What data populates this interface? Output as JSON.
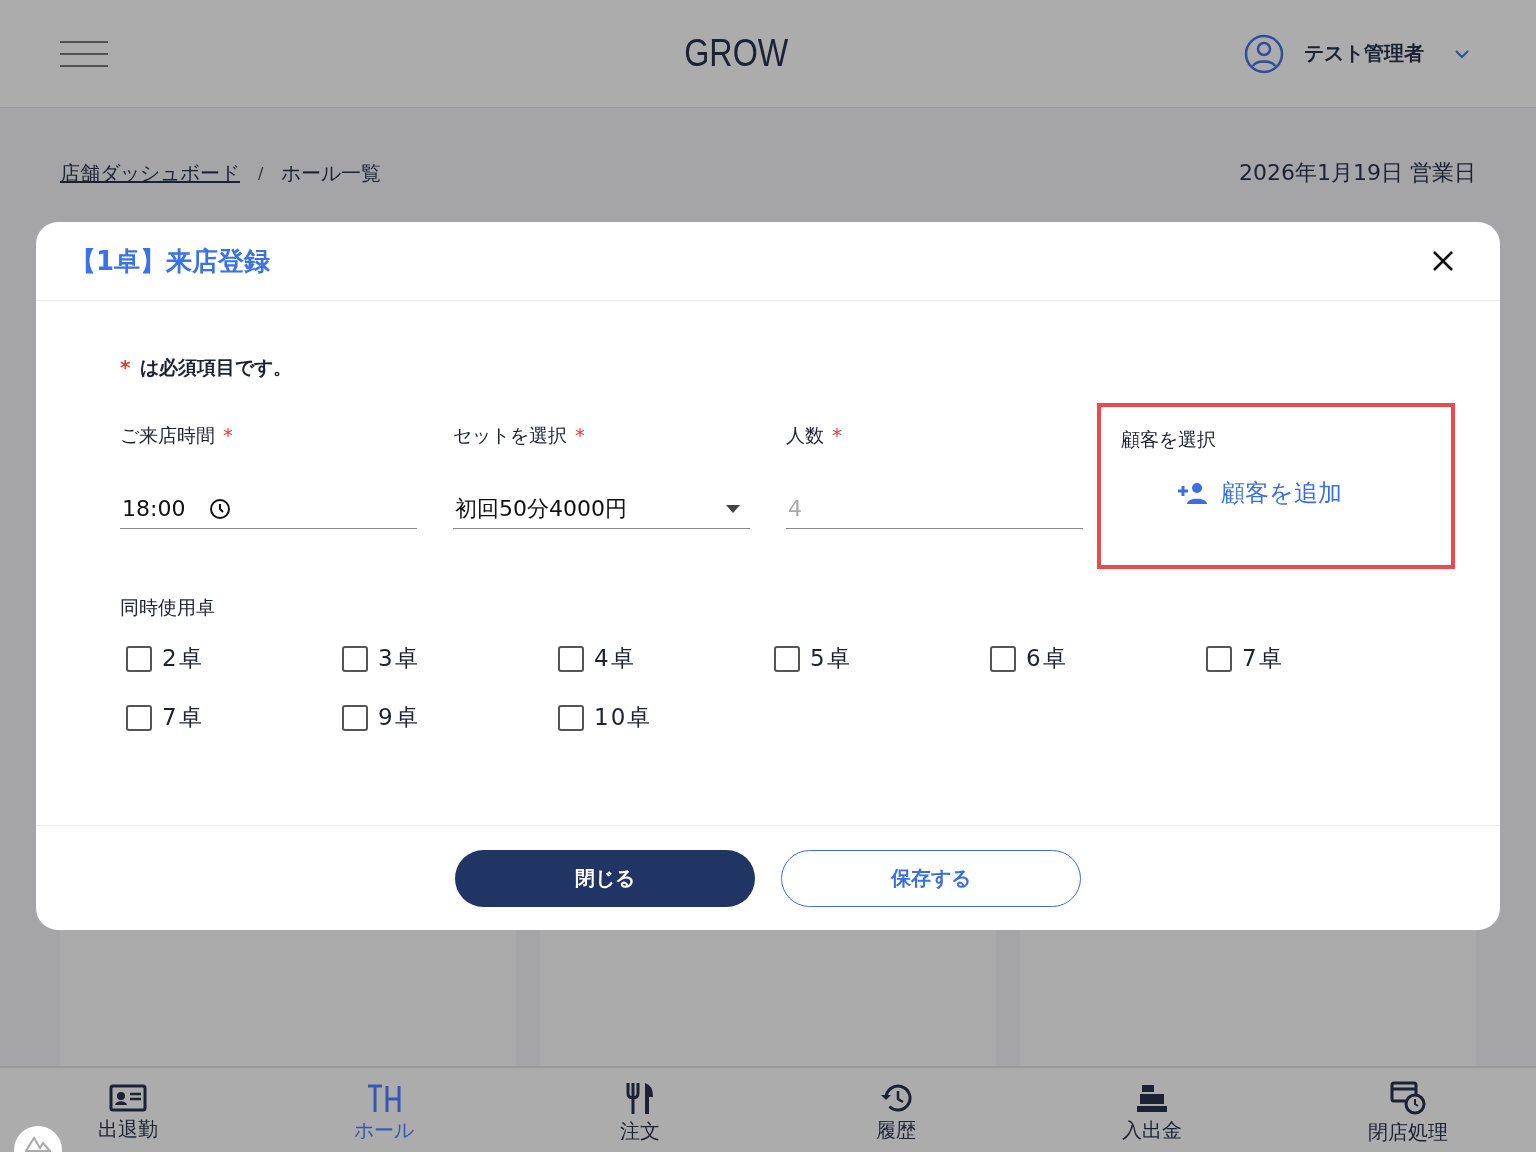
{
  "header": {
    "title": "GROW",
    "user": "テスト管理者"
  },
  "breadcrumb_separator": "/",
  "breadcrumb": [
    {
      "label": "店舗ダッシュボード",
      "link": true
    },
    {
      "label": "ホール一覧",
      "link": false
    }
  ],
  "business_date": "2026年1月19日 営業日",
  "dialog": {
    "title": "【1卓】来店登録",
    "required_note": "は必須項目です。",
    "required_mark": "*",
    "fields": [
      {
        "kind": "time",
        "label": "ご来店時間",
        "required": true,
        "value": "18:00"
      },
      {
        "kind": "select",
        "label": "セットを選択",
        "required": true,
        "value": "初回50分4000円"
      },
      {
        "kind": "text",
        "label": "人数",
        "required": true,
        "placeholder": "4"
      }
    ],
    "customer": {
      "label": "顧客を選択",
      "button": "顧客を追加",
      "highlighted": true
    },
    "tables_label": "同時使用卓",
    "tables": [
      {
        "label": "2卓",
        "checked": false
      },
      {
        "label": "3卓",
        "checked": false
      },
      {
        "label": "4卓",
        "checked": false
      },
      {
        "label": "5卓",
        "checked": false
      },
      {
        "label": "6卓",
        "checked": false
      },
      {
        "label": "7卓",
        "checked": false
      },
      {
        "label": "7卓",
        "checked": false
      },
      {
        "label": "9卓",
        "checked": false
      },
      {
        "label": "10卓",
        "checked": false
      }
    ],
    "buttons": [
      {
        "kind": "primary",
        "label": "閉じる"
      },
      {
        "kind": "outline",
        "label": "保存する"
      }
    ]
  },
  "nav": [
    {
      "kind": "attendance",
      "label": "出退勤",
      "selected": false
    },
    {
      "kind": "hall",
      "label": "ホール",
      "selected": true
    },
    {
      "kind": "order",
      "label": "注文",
      "selected": false
    },
    {
      "kind": "history",
      "label": "履歴",
      "selected": false
    },
    {
      "kind": "cash",
      "label": "入出金",
      "selected": false
    },
    {
      "kind": "close",
      "label": "閉店処理",
      "selected": false
    }
  ]
}
